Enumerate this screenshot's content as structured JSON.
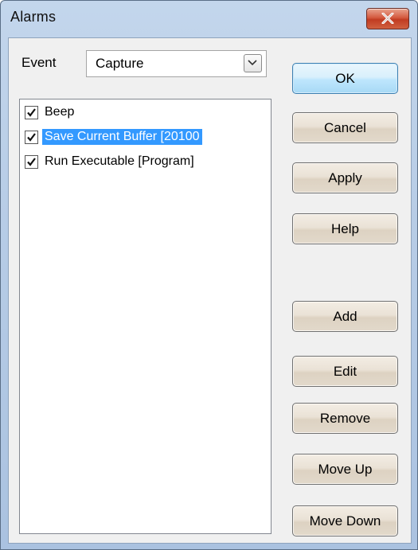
{
  "window": {
    "title": "Alarms"
  },
  "event": {
    "label": "Event",
    "selected": "Capture"
  },
  "alarms": {
    "items": [
      {
        "label": "Beep",
        "checked": true,
        "selected": false
      },
      {
        "label": "Save Current Buffer [20100",
        "checked": true,
        "selected": true
      },
      {
        "label": "Run Executable [Program]",
        "checked": true,
        "selected": false
      }
    ]
  },
  "buttons": {
    "ok": "OK",
    "cancel": "Cancel",
    "apply": "Apply",
    "help": "Help",
    "add": "Add",
    "edit": "Edit",
    "remove": "Remove",
    "move_up": "Move Up",
    "move_down": "Move Down"
  },
  "colors": {
    "selection": "#3399ff",
    "close_button": "#c13c22",
    "default_button": "#a7d9f5"
  }
}
